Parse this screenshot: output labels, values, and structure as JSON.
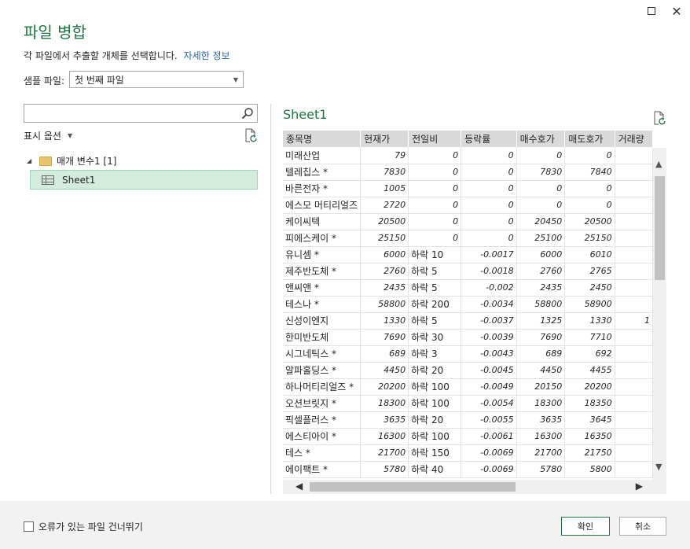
{
  "window": {
    "maximize_label": "",
    "close_label": "✕"
  },
  "header": {
    "title": "파일 병합",
    "subtitle": "각 파일에서 추출할 개체를 선택합니다.",
    "learn_more": "자세한 정보"
  },
  "sample": {
    "label": "샘플 파일:",
    "value": "첫 번째 파일"
  },
  "left_panel": {
    "search_placeholder": "",
    "display_options": "표시 옵션",
    "tree": {
      "folder_label": "매개 변수1 [1]",
      "sheet_label": "Sheet1"
    }
  },
  "preview": {
    "title": "Sheet1",
    "columns": [
      "종목명",
      "현재가",
      "전일비",
      "등락률",
      "매수호가",
      "매도호가",
      "거래량"
    ],
    "rows": [
      [
        "미래산업",
        "79",
        "0",
        "0",
        "0",
        "0",
        ""
      ],
      [
        "텔레칩스 *",
        "7830",
        "0",
        "0",
        "7830",
        "7840",
        ""
      ],
      [
        "바른전자 *",
        "1005",
        "0",
        "0",
        "0",
        "0",
        ""
      ],
      [
        "에스모 머티리얼즈",
        "2720",
        "0",
        "0",
        "0",
        "0",
        ""
      ],
      [
        "케이씨텍",
        "20500",
        "0",
        "0",
        "20450",
        "20500",
        ""
      ],
      [
        "피에스케이 *",
        "25150",
        "0",
        "0",
        "25100",
        "25150",
        ""
      ],
      [
        "유니셈 *",
        "6000",
        "하락 10",
        "-0.0017",
        "6000",
        "6010",
        ""
      ],
      [
        "제주반도체 *",
        "2760",
        "하락 5",
        "-0.0018",
        "2760",
        "2765",
        ""
      ],
      [
        "앤씨앤 *",
        "2435",
        "하락 5",
        "-0.002",
        "2435",
        "2450",
        ""
      ],
      [
        "테스나 *",
        "58800",
        "하락 200",
        "-0.0034",
        "58800",
        "58900",
        ""
      ],
      [
        "신성이엔지",
        "1330",
        "하락 5",
        "-0.0037",
        "1325",
        "1330",
        "1"
      ],
      [
        "한미반도체",
        "7690",
        "하락 30",
        "-0.0039",
        "7690",
        "7710",
        ""
      ],
      [
        "시그네틱스 *",
        "689",
        "하락 3",
        "-0.0043",
        "689",
        "692",
        ""
      ],
      [
        "알파홀딩스 *",
        "4450",
        "하락 20",
        "-0.0045",
        "4450",
        "4455",
        ""
      ],
      [
        "하나머티리얼즈 *",
        "20200",
        "하락 100",
        "-0.0049",
        "20150",
        "20200",
        ""
      ],
      [
        "오션브릿지 *",
        "18300",
        "하락 100",
        "-0.0054",
        "18300",
        "18350",
        ""
      ],
      [
        "픽셀플러스 *",
        "3635",
        "하락 20",
        "-0.0055",
        "3635",
        "3645",
        ""
      ],
      [
        "에스티아이 *",
        "16300",
        "하락 100",
        "-0.0061",
        "16300",
        "16350",
        ""
      ],
      [
        "테스 *",
        "21700",
        "하락 150",
        "-0.0069",
        "21700",
        "21750",
        ""
      ],
      [
        "에이팩트 *",
        "5780",
        "하락 40",
        "-0.0069",
        "5780",
        "5800",
        ""
      ]
    ]
  },
  "footer": {
    "skip_errors_label": "오류가 있는 파일 건너뛰기",
    "ok_label": "확인",
    "cancel_label": "취소"
  },
  "colors": {
    "accent": "#217346",
    "link": "#2467b1",
    "selection": "#d3ecdd"
  },
  "icons": [
    "maximize-icon",
    "close-icon",
    "search-icon",
    "refresh-icon",
    "folder-icon",
    "sheet-icon"
  ]
}
